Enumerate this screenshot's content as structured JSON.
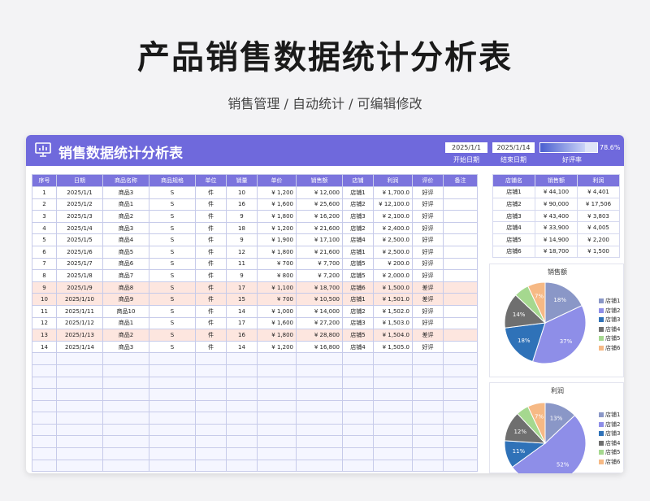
{
  "page": {
    "title": "产品销售数据统计分析表",
    "subtitle": "销售管理 / 自动统计 / 可编辑修改"
  },
  "sheet": {
    "title": "销售数据统计分析表",
    "start_date": "2025/1/1",
    "end_date": "2025/1/14",
    "start_label": "开始日期",
    "end_label": "结束日期",
    "good_rate_text": "78.6%",
    "good_rate_value": 0.786,
    "good_rate_label": "好评率"
  },
  "main_table": {
    "headers": [
      "序号",
      "日期",
      "商品名称",
      "商品规格",
      "单位",
      "销量",
      "单价",
      "销售额",
      "店铺",
      "利润",
      "评价",
      "备注"
    ],
    "rows": [
      [
        "1",
        "2025/1/1",
        "商品3",
        "S",
        "件",
        "10",
        "¥ 1,200",
        "¥ 12,000",
        "店铺1",
        "¥ 1,700.0",
        "好评",
        ""
      ],
      [
        "2",
        "2025/1/2",
        "商品1",
        "S",
        "件",
        "16",
        "¥ 1,600",
        "¥ 25,600",
        "店铺2",
        "¥ 12,100.0",
        "好评",
        ""
      ],
      [
        "3",
        "2025/1/3",
        "商品2",
        "S",
        "件",
        "9",
        "¥ 1,800",
        "¥ 16,200",
        "店铺3",
        "¥ 2,100.0",
        "好评",
        ""
      ],
      [
        "4",
        "2025/1/4",
        "商品3",
        "S",
        "件",
        "18",
        "¥ 1,200",
        "¥ 21,600",
        "店铺2",
        "¥ 2,400.0",
        "好评",
        ""
      ],
      [
        "5",
        "2025/1/5",
        "商品4",
        "S",
        "件",
        "9",
        "¥ 1,900",
        "¥ 17,100",
        "店铺4",
        "¥ 2,500.0",
        "好评",
        ""
      ],
      [
        "6",
        "2025/1/6",
        "商品5",
        "S",
        "件",
        "12",
        "¥ 1,800",
        "¥ 21,600",
        "店铺1",
        "¥ 2,500.0",
        "好评",
        ""
      ],
      [
        "7",
        "2025/1/7",
        "商品6",
        "S",
        "件",
        "11",
        "¥ 700",
        "¥ 7,700",
        "店铺5",
        "¥ 200.0",
        "好评",
        ""
      ],
      [
        "8",
        "2025/1/8",
        "商品7",
        "S",
        "件",
        "9",
        "¥ 800",
        "¥ 7,200",
        "店铺5",
        "¥ 2,000.0",
        "好评",
        ""
      ],
      [
        "9",
        "2025/1/9",
        "商品8",
        "S",
        "件",
        "17",
        "¥ 1,100",
        "¥ 18,700",
        "店铺6",
        "¥ 1,500.0",
        "差评",
        ""
      ],
      [
        "10",
        "2025/1/10",
        "商品9",
        "S",
        "件",
        "15",
        "¥ 700",
        "¥ 10,500",
        "店铺1",
        "¥ 1,501.0",
        "差评",
        ""
      ],
      [
        "11",
        "2025/1/11",
        "商品10",
        "S",
        "件",
        "14",
        "¥ 1,000",
        "¥ 14,000",
        "店铺2",
        "¥ 1,502.0",
        "好评",
        ""
      ],
      [
        "12",
        "2025/1/12",
        "商品1",
        "S",
        "件",
        "17",
        "¥ 1,600",
        "¥ 27,200",
        "店铺3",
        "¥ 1,503.0",
        "好评",
        ""
      ],
      [
        "13",
        "2025/1/13",
        "商品2",
        "S",
        "件",
        "16",
        "¥ 1,800",
        "¥ 28,800",
        "店铺5",
        "¥ 1,504.0",
        "差评",
        ""
      ],
      [
        "14",
        "2025/1/14",
        "商品3",
        "S",
        "件",
        "14",
        "¥ 1,200",
        "¥ 16,800",
        "店铺4",
        "¥ 1,505.0",
        "好评",
        ""
      ]
    ],
    "bad_review_text": "差评"
  },
  "side_table": {
    "headers": [
      "店铺名",
      "销售额",
      "利润"
    ],
    "rows": [
      [
        "店铺1",
        "¥ 44,100",
        "¥ 4,401"
      ],
      [
        "店铺2",
        "¥ 90,000",
        "¥ 17,506"
      ],
      [
        "店铺3",
        "¥ 43,400",
        "¥ 3,803"
      ],
      [
        "店铺4",
        "¥ 33,900",
        "¥ 4,005"
      ],
      [
        "店铺5",
        "¥ 14,900",
        "¥ 2,200"
      ],
      [
        "店铺6",
        "¥ 18,700",
        "¥ 1,500"
      ]
    ]
  },
  "chart_data": [
    {
      "type": "pie",
      "title": "销售额",
      "categories": [
        "店铺1",
        "店铺2",
        "店铺3",
        "店铺4",
        "店铺5",
        "店铺6"
      ],
      "values": [
        18,
        37,
        18,
        14,
        6,
        7
      ],
      "labels": [
        "18%",
        "37%",
        "18%",
        "14%",
        "",
        "7%"
      ],
      "colors": [
        "#8a97c7",
        "#8e8ee8",
        "#2f72b8",
        "#6f6f6f",
        "#a5d88f",
        "#f6b985"
      ],
      "legend": "right"
    },
    {
      "type": "pie",
      "title": "利润",
      "categories": [
        "店铺1",
        "店铺2",
        "店铺3",
        "店铺4",
        "店铺5",
        "店铺6"
      ],
      "values": [
        13,
        52,
        11,
        12,
        5,
        7
      ],
      "labels": [
        "13%",
        "52%",
        "11%",
        "12%",
        "",
        "7%"
      ],
      "colors": [
        "#8a97c7",
        "#8e8ee8",
        "#2f72b8",
        "#6f6f6f",
        "#a5d88f",
        "#f6b985"
      ],
      "legend": "right"
    }
  ],
  "colors": {
    "header": "#6f69dc",
    "table_header": "#7b74dd",
    "bad_row": "#fde6df"
  },
  "icons": {
    "sheet": "monitor-chart-icon"
  }
}
